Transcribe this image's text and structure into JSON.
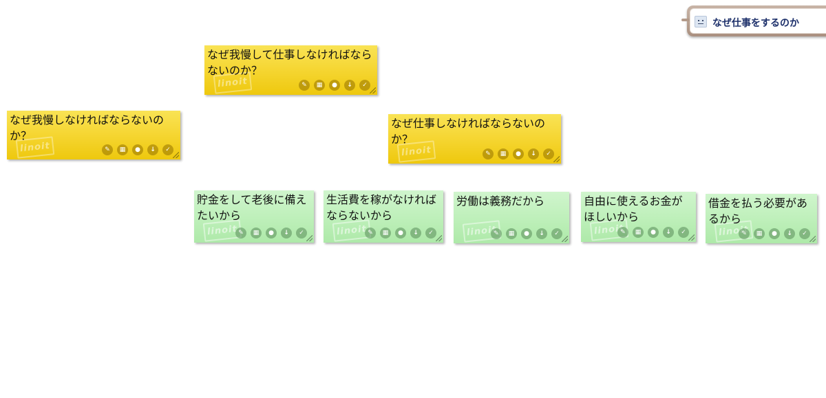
{
  "board_tab": {
    "title": "なぜ仕事をするのか",
    "icon": "board-face-icon"
  },
  "note_watermark": "linoit",
  "note_actions": [
    {
      "name": "edit-icon",
      "glyph": "✎"
    },
    {
      "name": "calendar-icon",
      "glyph": "▦"
    },
    {
      "name": "user-icon",
      "glyph": "●"
    },
    {
      "name": "download-icon",
      "glyph": "↓"
    },
    {
      "name": "check-icon",
      "glyph": "✓"
    }
  ],
  "colors": {
    "yellow_note": "#f6d735",
    "green_note": "#bff0bb",
    "tab": "#b9a293",
    "tab_title": "#1c2f6a"
  },
  "notes": [
    {
      "text": "なぜ我慢して仕事しなければならないのか？",
      "color": "yellow"
    },
    {
      "text": "なぜ我慢しなければならないのか？",
      "color": "yellow"
    },
    {
      "text": "なぜ仕事しなければならないのか？",
      "color": "yellow"
    },
    {
      "text": "貯金をして老後に備えたいから",
      "color": "green"
    },
    {
      "text": "生活費を稼がなければならないから",
      "color": "green"
    },
    {
      "text": "労働は義務だから",
      "color": "green"
    },
    {
      "text": "自由に使えるお金がほしいから",
      "color": "green"
    },
    {
      "text": "借金を払う必要があるから",
      "color": "green"
    }
  ]
}
